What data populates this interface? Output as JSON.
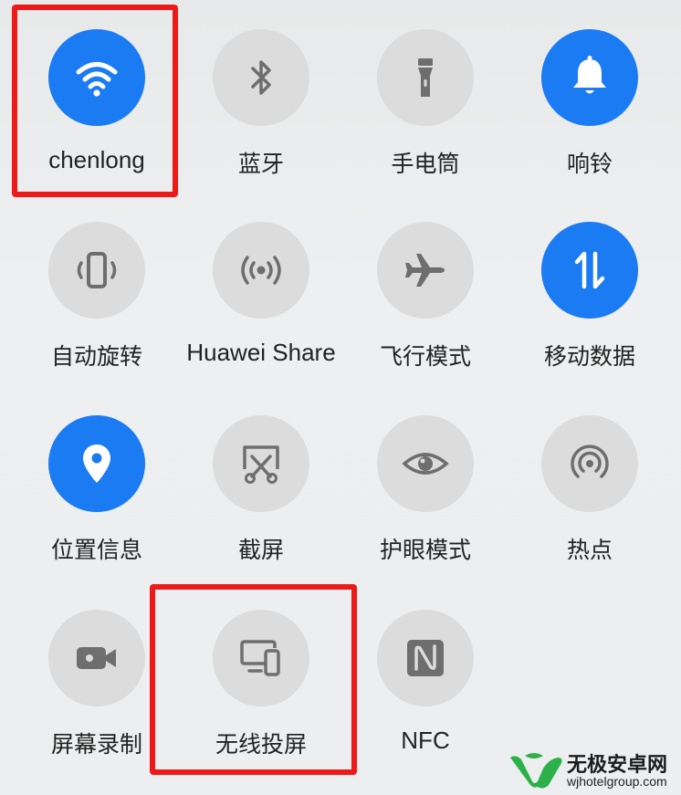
{
  "tiles": [
    {
      "name": "tile-wifi",
      "label": "chenlong",
      "icon": "wifi-icon",
      "state": "on"
    },
    {
      "name": "tile-bluetooth",
      "label": "蓝牙",
      "icon": "bluetooth-icon",
      "state": "off"
    },
    {
      "name": "tile-flashlight",
      "label": "手电筒",
      "icon": "flashlight-icon",
      "state": "off"
    },
    {
      "name": "tile-ringer",
      "label": "响铃",
      "icon": "bell-icon",
      "state": "on"
    },
    {
      "name": "tile-auto-rotate",
      "label": "自动旋转",
      "icon": "rotate-icon",
      "state": "off"
    },
    {
      "name": "tile-huawei-share",
      "label": "Huawei Share",
      "icon": "share-waves-icon",
      "state": "off"
    },
    {
      "name": "tile-airplane-mode",
      "label": "飞行模式",
      "icon": "airplane-icon",
      "state": "off"
    },
    {
      "name": "tile-mobile-data",
      "label": "移动数据",
      "icon": "data-arrows-icon",
      "state": "on"
    },
    {
      "name": "tile-location",
      "label": "位置信息",
      "icon": "location-pin-icon",
      "state": "on"
    },
    {
      "name": "tile-screenshot",
      "label": "截屏",
      "icon": "scissors-screen-icon",
      "state": "off"
    },
    {
      "name": "tile-eye-comfort",
      "label": "护眼模式",
      "icon": "eye-icon",
      "state": "off"
    },
    {
      "name": "tile-hotspot",
      "label": "热点",
      "icon": "hotspot-icon",
      "state": "off"
    },
    {
      "name": "tile-screen-record",
      "label": "屏幕录制",
      "icon": "video-camera-icon",
      "state": "off"
    },
    {
      "name": "tile-wireless-projection",
      "label": "无线投屏",
      "icon": "projection-devices-icon",
      "state": "off"
    },
    {
      "name": "tile-nfc",
      "label": "NFC",
      "icon": "nfc-icon",
      "state": "off"
    }
  ],
  "colors": {
    "active": "#1a7bf2",
    "inactive": "#dcdcdc",
    "icon_inactive": "#6e6e6e",
    "highlight": "#ee1a1a"
  },
  "watermark": {
    "title": "无极安卓网",
    "url": "wjhotelgroup.com"
  }
}
